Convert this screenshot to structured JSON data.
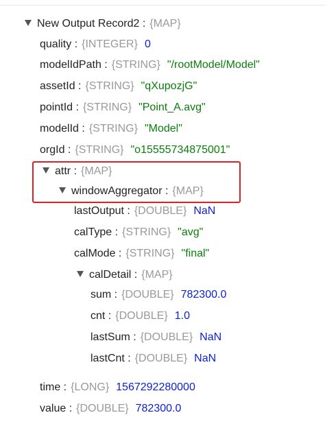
{
  "root": {
    "key": "New Output Record2",
    "type": "{MAP}"
  },
  "fields": [
    {
      "key": "quality",
      "type": "{INTEGER}",
      "value": "0",
      "kind": "num"
    },
    {
      "key": "modelIdPath",
      "type": "{STRING}",
      "value": "\"/rootModel/Model\"",
      "kind": "str"
    },
    {
      "key": "assetId",
      "type": "{STRING}",
      "value": "\"qXupozjG\"",
      "kind": "str"
    },
    {
      "key": "pointId",
      "type": "{STRING}",
      "value": "\"Point_A.avg\"",
      "kind": "str"
    },
    {
      "key": "modelId",
      "type": "{STRING}",
      "value": "\"Model\"",
      "kind": "str"
    },
    {
      "key": "orgId",
      "type": "{STRING}",
      "value": "\"o15555734875001\"",
      "kind": "str"
    }
  ],
  "attr": {
    "key": "attr",
    "type": "{MAP}"
  },
  "windowAggregator": {
    "key": "windowAggregator",
    "type": "{MAP}"
  },
  "wa_fields": [
    {
      "key": "lastOutput",
      "type": "{DOUBLE}",
      "value": "NaN",
      "kind": "num"
    },
    {
      "key": "calType",
      "type": "{STRING}",
      "value": "\"avg\"",
      "kind": "str"
    },
    {
      "key": "calMode",
      "type": "{STRING}",
      "value": "\"final\"",
      "kind": "str"
    }
  ],
  "calDetail": {
    "key": "calDetail",
    "type": "{MAP}"
  },
  "cd_fields": [
    {
      "key": "sum",
      "type": "{DOUBLE}",
      "value": "782300.0",
      "kind": "num"
    },
    {
      "key": "cnt",
      "type": "{DOUBLE}",
      "value": "1.0",
      "kind": "num"
    },
    {
      "key": "lastSum",
      "type": "{DOUBLE}",
      "value": "NaN",
      "kind": "num"
    },
    {
      "key": "lastCnt",
      "type": "{DOUBLE}",
      "value": "NaN",
      "kind": "num"
    }
  ],
  "tail_fields": [
    {
      "key": "time",
      "type": "{LONG}",
      "value": "1567292280000",
      "kind": "num"
    },
    {
      "key": "value",
      "type": "{DOUBLE}",
      "value": "782300.0",
      "kind": "num"
    }
  ],
  "colors": {
    "number": "#0b1fd3",
    "string": "#0a7d0a",
    "type": "#999999",
    "highlight": "#e02020"
  }
}
